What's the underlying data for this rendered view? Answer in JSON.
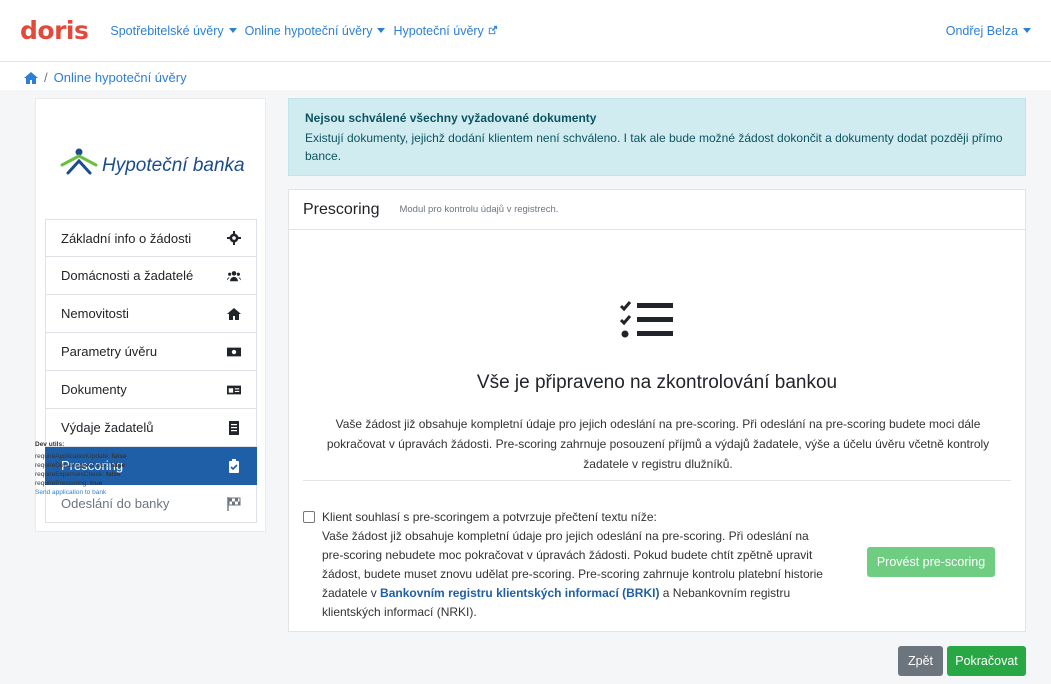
{
  "navbar": {
    "logo": "doris",
    "items": [
      {
        "label": "Spotřebitelské úvěry",
        "dropdown": true
      },
      {
        "label": "Online hypoteční úvěry",
        "dropdown": true
      },
      {
        "label": "Hypoteční úvěry",
        "external": true
      }
    ],
    "user": "Ondřej Belza"
  },
  "breadcrumb": {
    "separator": "/",
    "current": "Online hypoteční úvěry"
  },
  "sidebar": {
    "bank_name": "Hypoteční banka",
    "items": [
      {
        "label": "Základní info o žádosti",
        "icon": "gear-icon"
      },
      {
        "label": "Domácnosti a žadatelé",
        "icon": "users-icon"
      },
      {
        "label": "Nemovitosti",
        "icon": "home-icon"
      },
      {
        "label": "Parametry úvěru",
        "icon": "money-icon"
      },
      {
        "label": "Dokumenty",
        "icon": "id-card-icon"
      },
      {
        "label": "Výdaje žadatelů",
        "icon": "receipt-icon"
      },
      {
        "label": "Prescoring",
        "icon": "clipboard-check-icon",
        "active": true
      },
      {
        "label": "Odeslání do banky",
        "icon": "flag-checkered-icon",
        "disabled": true
      }
    ]
  },
  "dev_utils": {
    "title": "Dev utils:",
    "flags": [
      {
        "key": "requireApplicationUpdate:",
        "value": "false"
      },
      {
        "key": "requireDocumentsCheck:",
        "value": "false"
      },
      {
        "key": "requireExpensesCheck:",
        "value": "false"
      },
      {
        "key": "requirePrescoring:",
        "value": "true"
      }
    ],
    "link": "Send application to bank"
  },
  "alert": {
    "title": "Nejsou schválené všechny vyžadované dokumenty",
    "text": "Existují dokumenty, jejichž dodání klientem není schváleno. I tak ale bude možné žádost dokončit a dokumenty dodat později přímo bance."
  },
  "card": {
    "title": "Prescoring",
    "subtitle": "Modul pro kontrolu údajů v registrech.",
    "big_title": "Vše je připraveno na zkontrolování bankou",
    "big_text": "Vaše žádost již obsahuje kompletní údaje pro jejich odeslání na pre-scoring. Při odeslání na pre-scoring budete moci dále pokračovat v úpravách žádosti. Pre-scoring zahrnuje posouzení příjmů a výdajů žadatele, výše a účelu úvěru včetně kontroly žadatele v registru dlužníků.",
    "consent_title": "Klient souhlasí s pre-scoringem a potvrzuje přečtení textu níže:",
    "consent_text_1": "Vaše žádost již obsahuje kompletní údaje pro jejich odeslání na pre-scoring. Při odeslání na pre-scoring nebudete moc pokračovat v úpravách žádosti. Pokud budete chtít zpětně upravit žádost, budete muset znovu udělat pre-scoring. Pre-scoring zahrnuje kontrolu platební historie žadatele v ",
    "consent_link": "Bankovním registru klientských informací (BRKI)",
    "consent_text_2": " a Nebankovním registru klientských informací (NRKI).",
    "consent_checked": false,
    "prescore_button": "Provést pre-scoring"
  },
  "footer": {
    "back_button": "Zpět",
    "next_button": "Pokračovat"
  },
  "colors": {
    "brand": "#e3493b",
    "link": "#2d7fd6",
    "active": "#1f5fa8",
    "success": "#28a745",
    "alert_bg": "#d1ecf1"
  }
}
